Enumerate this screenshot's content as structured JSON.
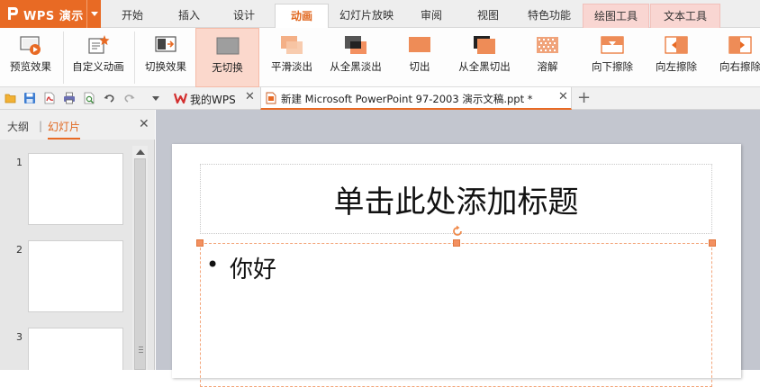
{
  "app": {
    "title": "WPS 演示"
  },
  "menu": {
    "tabs": [
      {
        "label": "开始"
      },
      {
        "label": "插入"
      },
      {
        "label": "设计"
      },
      {
        "label": "动画"
      },
      {
        "label": "幻灯片放映"
      },
      {
        "label": "审阅"
      },
      {
        "label": "视图"
      },
      {
        "label": "特色功能"
      },
      {
        "label": "绘图工具"
      },
      {
        "label": "文本工具"
      }
    ],
    "active": "动画"
  },
  "ribbon": {
    "buttons": [
      {
        "label": "预览效果",
        "icon": "preview-effect-icon"
      },
      {
        "label": "自定义动画",
        "icon": "custom-animation-icon"
      },
      {
        "label": "切换效果",
        "icon": "transition-effect-icon"
      },
      {
        "label": "无切换",
        "icon": "no-transition-icon",
        "selected": true
      },
      {
        "label": "平滑淡出",
        "icon": "smooth-fade-icon"
      },
      {
        "label": "从全黑淡出",
        "icon": "fade-through-black-icon"
      },
      {
        "label": "切出",
        "icon": "cut-icon"
      },
      {
        "label": "从全黑切出",
        "icon": "cut-through-black-icon"
      },
      {
        "label": "溶解",
        "icon": "dissolve-icon"
      },
      {
        "label": "向下擦除",
        "icon": "wipe-down-icon"
      },
      {
        "label": "向左擦除",
        "icon": "wipe-left-icon"
      },
      {
        "label": "向右擦除",
        "icon": "wipe-right-icon"
      }
    ]
  },
  "quickbar": {
    "icons": [
      "open-icon",
      "save-icon",
      "export-pdf-icon",
      "print-icon",
      "print-preview-icon",
      "undo-icon",
      "redo-icon",
      "more-dropdown-icon"
    ]
  },
  "doc_tabs": [
    {
      "label": "我的WPS",
      "icon": "wps-home-icon"
    },
    {
      "label": "新建 Microsoft PowerPoint 97-2003 演示文稿.ppt *",
      "icon": "ppt-file-icon",
      "active": true
    }
  ],
  "left_panel": {
    "tabs": [
      {
        "label": "大纲"
      },
      {
        "label": "幻灯片"
      }
    ],
    "active": "幻灯片",
    "slides": [
      {
        "num": "1"
      },
      {
        "num": "2"
      },
      {
        "num": "3"
      }
    ]
  },
  "slide": {
    "title_placeholder": "单击此处添加标题",
    "body_text": "你好"
  },
  "colors": {
    "accent": "#e86a24",
    "selected_bg": "#fbd8cc",
    "context_tab_bg": "#f9d6d2",
    "edit_area_bg": "#c3c6cf"
  }
}
